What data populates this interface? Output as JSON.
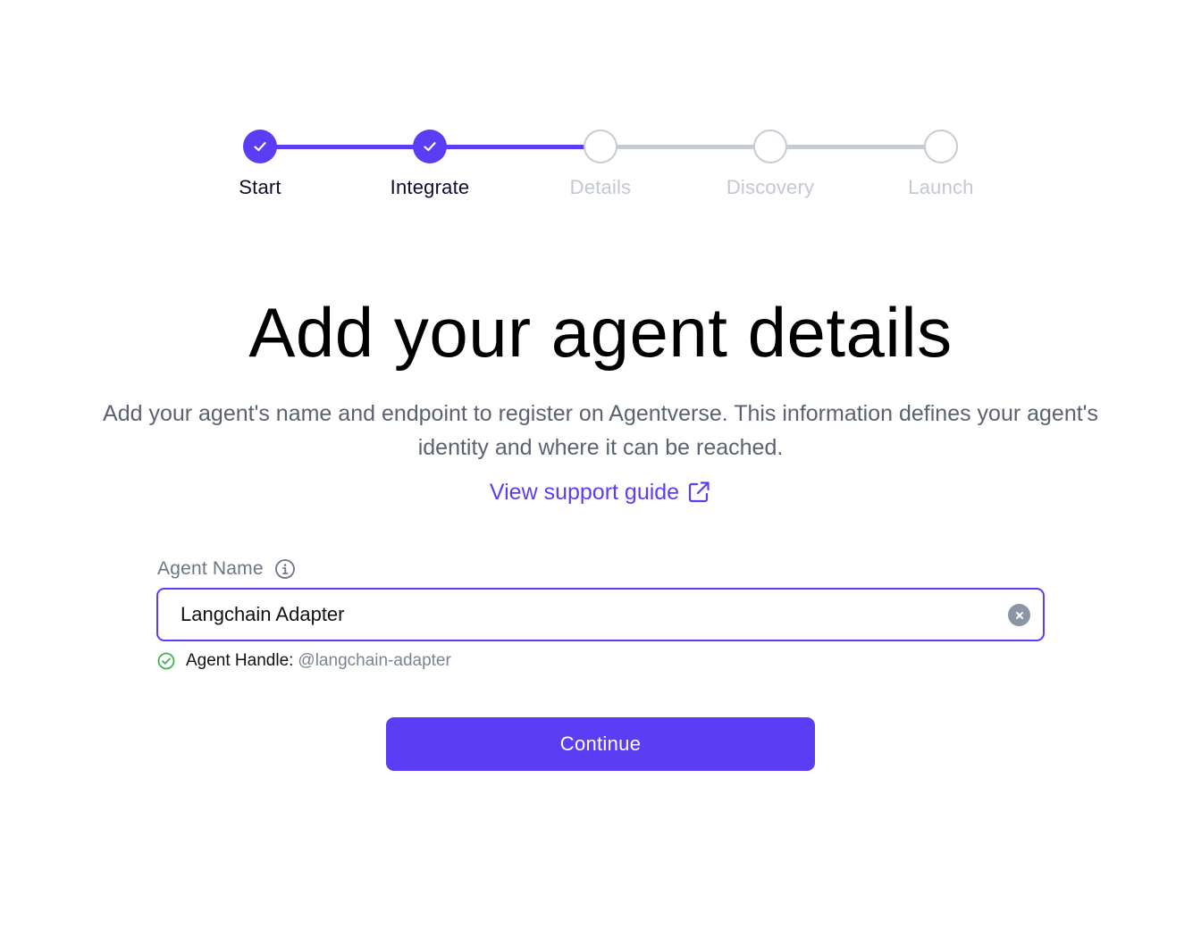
{
  "stepper": {
    "steps": [
      {
        "label": "Start",
        "status": "complete"
      },
      {
        "label": "Integrate",
        "status": "complete"
      },
      {
        "label": "Details",
        "status": "upcoming"
      },
      {
        "label": "Discovery",
        "status": "upcoming"
      },
      {
        "label": "Launch",
        "status": "upcoming"
      }
    ]
  },
  "header": {
    "title": "Add your agent details",
    "subtitle": "Add your agent's name and endpoint to register on Agentverse. This information defines your agent's identity and where it can be reached.",
    "support_link_label": "View support guide"
  },
  "form": {
    "agent_name_label": "Agent Name",
    "agent_name_value": "Langchain Adapter",
    "handle_label": "Agent Handle:",
    "handle_value": "@langchain-adapter"
  },
  "actions": {
    "continue_label": "Continue"
  },
  "icons": {
    "step_complete": "check-icon",
    "info": "info-icon",
    "clear": "clear-icon",
    "external_link": "external-link-icon",
    "handle_status": "check-circle-icon"
  },
  "colors": {
    "accent": "#5b3df5",
    "inactive": "#c6cbd4",
    "success": "#3bb54a",
    "muted_text": "#5a6270"
  }
}
